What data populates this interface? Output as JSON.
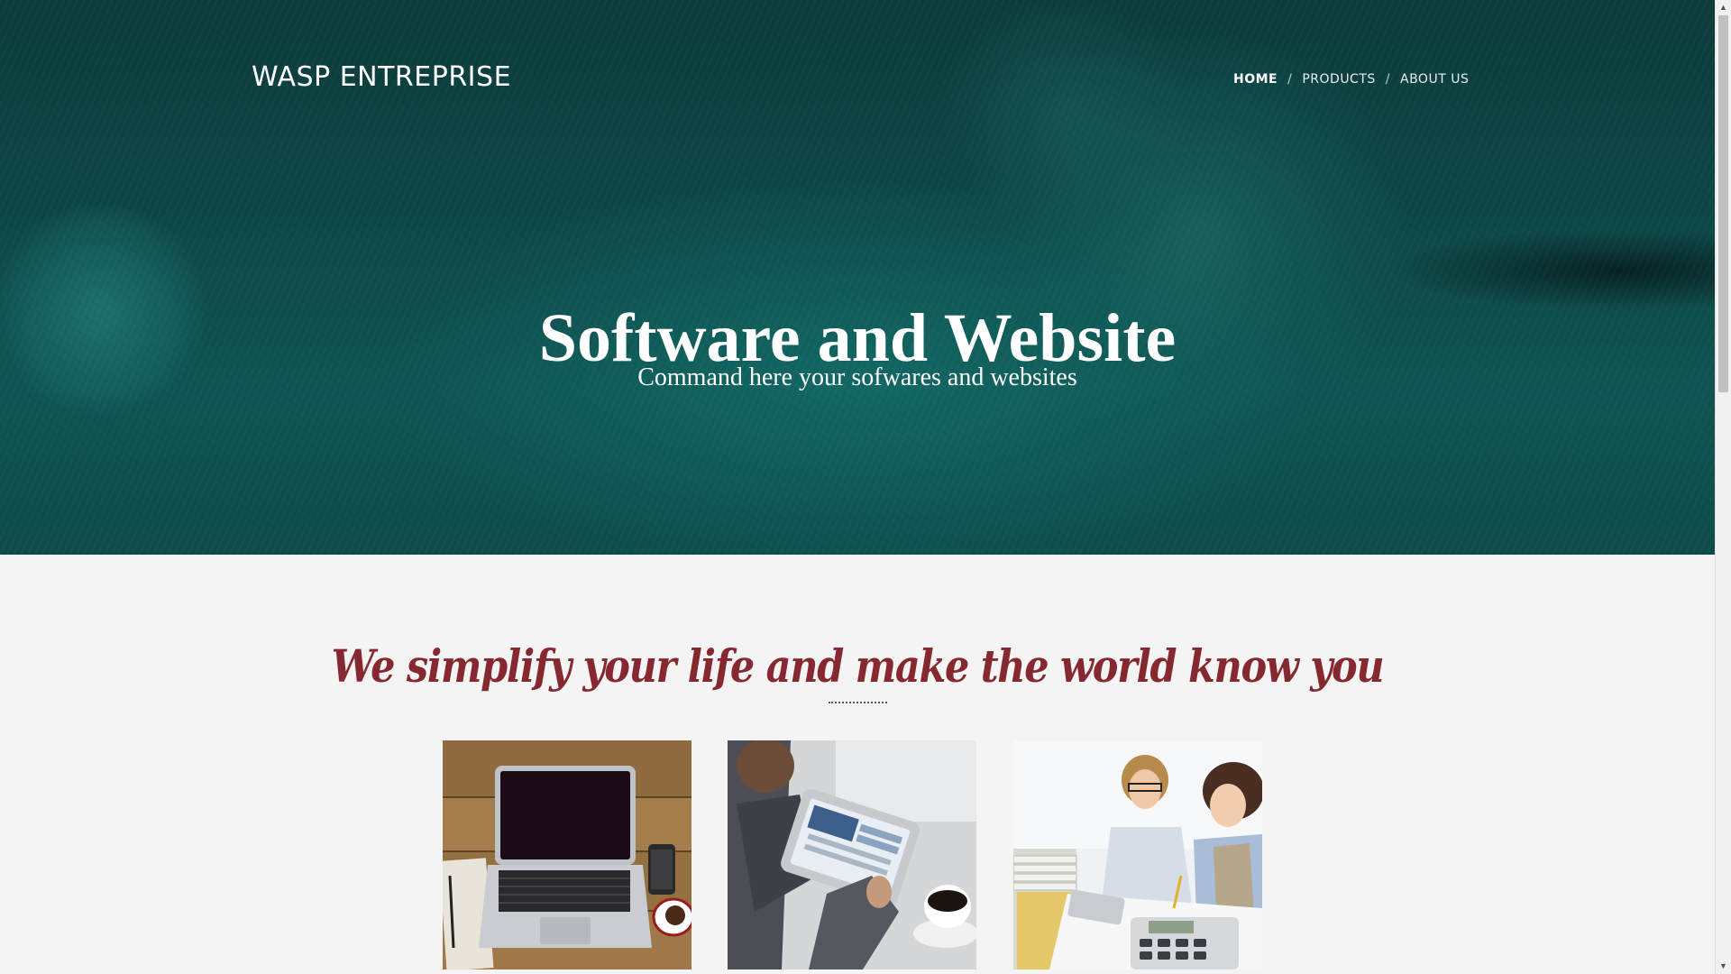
{
  "header": {
    "logo": "WASP ENTREPRISE",
    "nav": {
      "home": "HOME",
      "products": "PRODUCTS",
      "about": "ABOUT US",
      "separator": "/"
    }
  },
  "hero": {
    "title": "Software and Website",
    "subtitle": "Command here your sofwares and websites"
  },
  "section": {
    "tagline": "We simplify your life and make the world know you",
    "divider": "..............."
  },
  "cards": [
    {
      "image": "laptop-on-wooden-desk"
    },
    {
      "image": "person-using-tablet-with-coffee"
    },
    {
      "image": "two-women-working-with-calculator"
    }
  ],
  "colors": {
    "hero_background": "#0e4a4a",
    "tagline": "#86282f",
    "page_background": "#f4f4f4"
  },
  "icons": {
    "scroll_up": "scroll-up-arrow-icon",
    "scroll_down": "scroll-down-arrow-icon"
  }
}
